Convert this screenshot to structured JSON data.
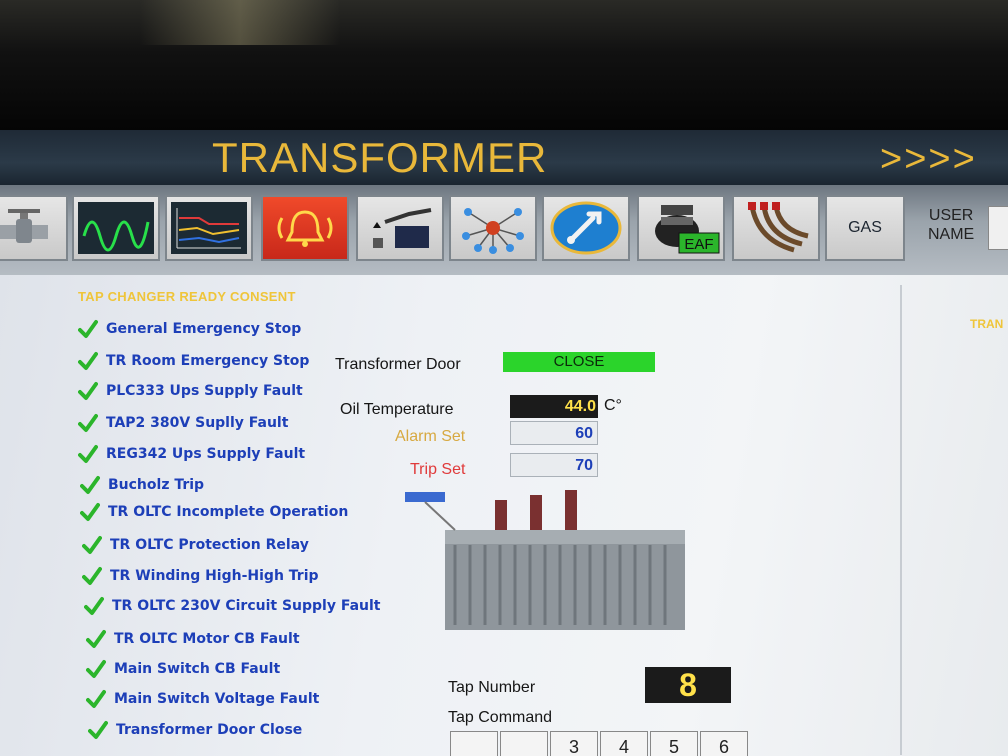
{
  "header": {
    "title": "TRANSFORMER",
    "nav_arrows": ">>>>"
  },
  "toolbar": {
    "buttons": [
      {
        "name": "valve",
        "icon": "valve-icon"
      },
      {
        "name": "waveform",
        "icon": "waveform-icon"
      },
      {
        "name": "trend",
        "icon": "trend-chart-icon"
      },
      {
        "name": "alarm",
        "icon": "alarm-bell-icon"
      },
      {
        "name": "oil-pump",
        "icon": "oil-pump-icon"
      },
      {
        "name": "network",
        "icon": "network-icon"
      },
      {
        "name": "maintenance",
        "icon": "wrench-icon"
      },
      {
        "name": "eaf",
        "icon": "eaf-furnace-icon",
        "label": "EAF"
      },
      {
        "name": "cables",
        "icon": "cables-icon"
      },
      {
        "name": "gas",
        "label": "GAS"
      }
    ],
    "user_name_label_1": "USER",
    "user_name_label_2": "NAME"
  },
  "consent": {
    "title": "TAP CHANGER READY CONSENT",
    "items": [
      "General Emergency Stop",
      "TR Room Emergency Stop",
      "PLC333 Ups Supply Fault",
      "TAP2 380V Suplly Fault",
      "REG342 Ups Supply Fault",
      "Bucholz Trip",
      "TR OLTC Incomplete Operation",
      "TR OLTC Protection Relay",
      "TR Winding High-High Trip",
      "TR OLTC 230V Circuit Supply Fault",
      "TR OLTC Motor CB Fault",
      "Main Switch CB Fault",
      "Main Switch Voltage Fault",
      "Transformer Door Close"
    ]
  },
  "status": {
    "door_label": "Transformer Door",
    "door_value": "CLOSE",
    "oil_temp_label": "Oil Temperature",
    "oil_temp_value": "44.0",
    "oil_temp_unit": "C°",
    "alarm_set_label": "Alarm Set",
    "alarm_set_value": "60",
    "trip_set_label": "Trip Set",
    "trip_set_value": "70"
  },
  "tap": {
    "number_label": "Tap Number",
    "number_value": "8",
    "command_label": "Tap Command",
    "commands": [
      "",
      "",
      "3",
      "4",
      "5",
      "6"
    ]
  },
  "right_panel": {
    "title": "TRAN"
  },
  "colors": {
    "title": "#e9b83a",
    "panel_title": "#efc53a",
    "check": "#2bb52b",
    "item_text": "#1d3fb8",
    "door_ok": "#2bd42b",
    "alarm": "#d7a941",
    "trip": "#e03a3a"
  }
}
